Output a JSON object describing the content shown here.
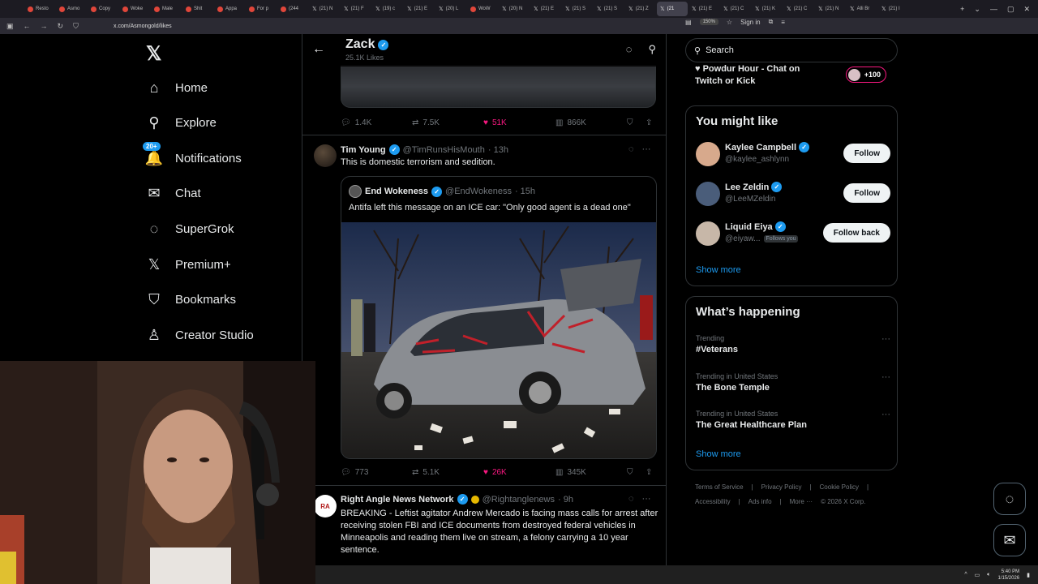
{
  "browser": {
    "tabs": [
      {
        "label": "Resto",
        "fav": "o"
      },
      {
        "label": "Asmo",
        "fav": "o"
      },
      {
        "label": "Copy",
        "fav": "o"
      },
      {
        "label": "Woke",
        "fav": "o"
      },
      {
        "label": "Male",
        "fav": "o"
      },
      {
        "label": "Shit",
        "fav": "o"
      },
      {
        "label": "Appa",
        "fav": "o"
      },
      {
        "label": "For p",
        "fav": "o"
      },
      {
        "label": "(244",
        "fav": "o"
      },
      {
        "label": "(21) N",
        "fav": "x"
      },
      {
        "label": "(21) F",
        "fav": "x"
      },
      {
        "label": "(19) c",
        "fav": "x"
      },
      {
        "label": "(21) E",
        "fav": "x"
      },
      {
        "label": "(20) L",
        "fav": "x"
      },
      {
        "label": "WoW",
        "fav": "o"
      },
      {
        "label": "(20) N",
        "fav": "x"
      },
      {
        "label": "(21) E",
        "fav": "x"
      },
      {
        "label": "(21) S",
        "fav": "x"
      },
      {
        "label": "(21) S",
        "fav": "x"
      },
      {
        "label": "(21) Z",
        "fav": "x"
      },
      {
        "label": "(21",
        "fav": "x",
        "active": true
      },
      {
        "label": "(21) E",
        "fav": "x"
      },
      {
        "label": "(21) C",
        "fav": "x"
      },
      {
        "label": "(21) K",
        "fav": "x"
      },
      {
        "label": "(21) C",
        "fav": "x"
      },
      {
        "label": "(21) N",
        "fav": "x"
      },
      {
        "label": "Alli Br",
        "fav": "x"
      },
      {
        "label": "(21) I",
        "fav": "x"
      }
    ],
    "url": "x.com/Asmongold/likes",
    "zoom": "150%",
    "sign_in": "Sign in"
  },
  "sidebar": {
    "items": [
      {
        "label": "Home",
        "icon": "home-icon",
        "glyph": "⌂"
      },
      {
        "label": "Explore",
        "icon": "search-icon",
        "glyph": "⚲"
      },
      {
        "label": "Notifications",
        "icon": "bell-icon",
        "glyph": "🔔",
        "badge": "20+"
      },
      {
        "label": "Chat",
        "icon": "mail-icon",
        "glyph": "✉"
      },
      {
        "label": "SuperGrok",
        "icon": "grok-icon",
        "glyph": "◌"
      },
      {
        "label": "Premium+",
        "icon": "x-icon",
        "glyph": "𝕏"
      },
      {
        "label": "Bookmarks",
        "icon": "bookmark-icon",
        "glyph": "⛉"
      },
      {
        "label": "Creator Studio",
        "icon": "creator-icon",
        "glyph": "♙"
      }
    ]
  },
  "header": {
    "name": "Zack",
    "subtitle": "25.1K Likes"
  },
  "tweet0": {
    "replies": "1.4K",
    "reposts": "7.5K",
    "likes": "51K",
    "views": "866K"
  },
  "tweet1": {
    "name": "Tim Young",
    "handle": "@TimRunsHisMouth",
    "time": "· 13h",
    "text": "This is domestic terrorism and sedition.",
    "quote": {
      "name": "End Wokeness",
      "handle": "@EndWokeness",
      "time": "· 15h",
      "text": "Antifa left this message on an ICE car: \"Only good agent is a dead one\""
    },
    "replies": "773",
    "reposts": "5.1K",
    "likes": "26K",
    "views": "345K"
  },
  "tweet2": {
    "name": "Right Angle News Network",
    "handle": "@Rightanglenews",
    "time": "· 9h",
    "text": "BREAKING - Leftist agitator Andrew Mercado is facing mass calls for arrest after receiving stolen FBI and ICE documents from destroyed federal vehicles in Minneapolis and reading them live on stream, a felony carrying a 10 year sentence."
  },
  "right": {
    "search_placeholder": "Search",
    "live": {
      "text": "Powdur Hour - Chat on Twitch or Kick",
      "count": "+100"
    },
    "wtf_title": "You might like",
    "wtf": [
      {
        "name": "Kaylee Campbell",
        "handle": "@kaylee_ashlynn",
        "button": "Follow",
        "color": "#d7a98c"
      },
      {
        "name": "Lee Zeldin",
        "handle": "@LeeMZeldin",
        "button": "Follow",
        "color": "#4a5d7a"
      },
      {
        "name": "Liquid Eiya",
        "handle": "@eiyaw...",
        "follows_you": "Follows you",
        "button": "Follow back",
        "color": "#c7b7a8"
      }
    ],
    "show_more": "Show more",
    "trends_title": "What’s happening",
    "trends": [
      {
        "context": "Trending",
        "title": "#Veterans"
      },
      {
        "context": "Trending in United States",
        "title": "The Bone Temple"
      },
      {
        "context": "Trending in United States",
        "title": "The Great Healthcare Plan"
      }
    ],
    "footer_line1": [
      "Terms of Service",
      "|",
      "Privacy Policy",
      "|",
      "Cookie Policy",
      "|"
    ],
    "footer_line2": [
      "Accessibility",
      "|",
      "Ads info",
      "|",
      "More ···",
      "© 2026 X Corp."
    ]
  },
  "taskbar": {
    "time": "5:40 PM",
    "date": "1/15/2026"
  }
}
